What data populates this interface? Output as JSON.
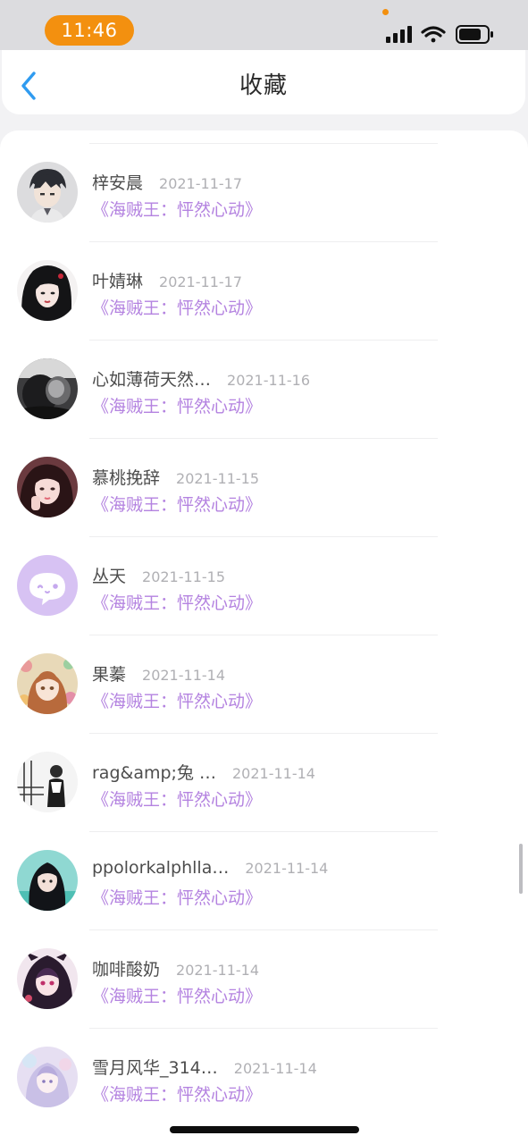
{
  "status_bar": {
    "time": "11:46",
    "icons": [
      "signal-icon",
      "wifi-icon",
      "battery-icon"
    ],
    "accent_color": "#f3900f"
  },
  "header": {
    "title": "收藏",
    "back_icon": "chevron-left-icon",
    "back_color": "#2f9bf0"
  },
  "favorites": [
    {
      "name": "梓安晨",
      "date": "2021-11-17",
      "work": "《海贼王：怦然心动》",
      "avatar": "avatar-boy-gray"
    },
    {
      "name": "叶婧琳",
      "date": "2021-11-17",
      "work": "《海贼王：怦然心动》",
      "avatar": "avatar-girl-dark-hair"
    },
    {
      "name": "心如薄荷天然…",
      "date": "2021-11-16",
      "work": "《海贼王：怦然心动》",
      "avatar": "avatar-black-white-photo"
    },
    {
      "name": "慕桃挽辞",
      "date": "2021-11-15",
      "work": "《海贼王：怦然心动》",
      "avatar": "avatar-girl-photo"
    },
    {
      "name": "丛天",
      "date": "2021-11-15",
      "work": "《海贼王：怦然心动》",
      "avatar": "avatar-default-chat-bubble"
    },
    {
      "name": "果蓁",
      "date": "2021-11-14",
      "work": "《海贼王：怦然心动》",
      "avatar": "avatar-floral-girl"
    },
    {
      "name": "rag&amp;兔 …",
      "date": "2021-11-14",
      "work": "《海贼王：怦然心动》",
      "avatar": "avatar-sketch-man"
    },
    {
      "name": "ppolorkalphlla…",
      "date": "2021-11-14",
      "work": "《海贼王：怦然心动》",
      "avatar": "avatar-teal-girl"
    },
    {
      "name": "咖啡酸奶",
      "date": "2021-11-14",
      "work": "《海贼王：怦然心动》",
      "avatar": "avatar-anime-hood"
    },
    {
      "name": "雪月风华_314…",
      "date": "2021-11-14",
      "work": "《海贼王：怦然心动》",
      "avatar": "avatar-pastel-girl"
    }
  ],
  "colors": {
    "link": "#b483e0",
    "name": "#4d4d4d",
    "date": "#b0b0b4"
  }
}
